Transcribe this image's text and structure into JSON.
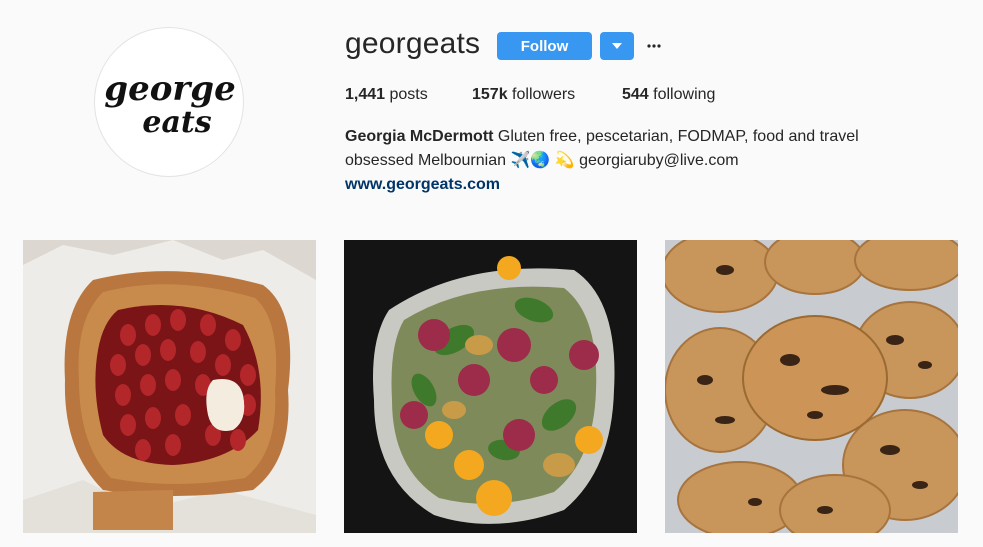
{
  "profile": {
    "username": "georgeats",
    "follow_label": "Follow",
    "avatar_logo_line1": "george",
    "avatar_logo_line2": "eats"
  },
  "stats": {
    "posts_count": "1,441",
    "posts_label": "posts",
    "followers_count": "157k",
    "followers_label": "followers",
    "following_count": "544",
    "following_label": "following"
  },
  "bio": {
    "full_name": "Georgia McDermott",
    "text_line1": "Gluten free, pescetarian, FODMAP, food and travel",
    "text_line2_a": "obsessed Melbournian",
    "emojis": "✈️🌏 💫",
    "email": "georgiaruby@live.com",
    "website": "www.georgeats.com"
  },
  "colors": {
    "accent": "#3897f0",
    "link": "#003569",
    "background": "#fafafa"
  },
  "posts": [
    {
      "name": "strawberry galette"
    },
    {
      "name": "salad with figs and citrus"
    },
    {
      "name": "chocolate chip cookies"
    }
  ]
}
